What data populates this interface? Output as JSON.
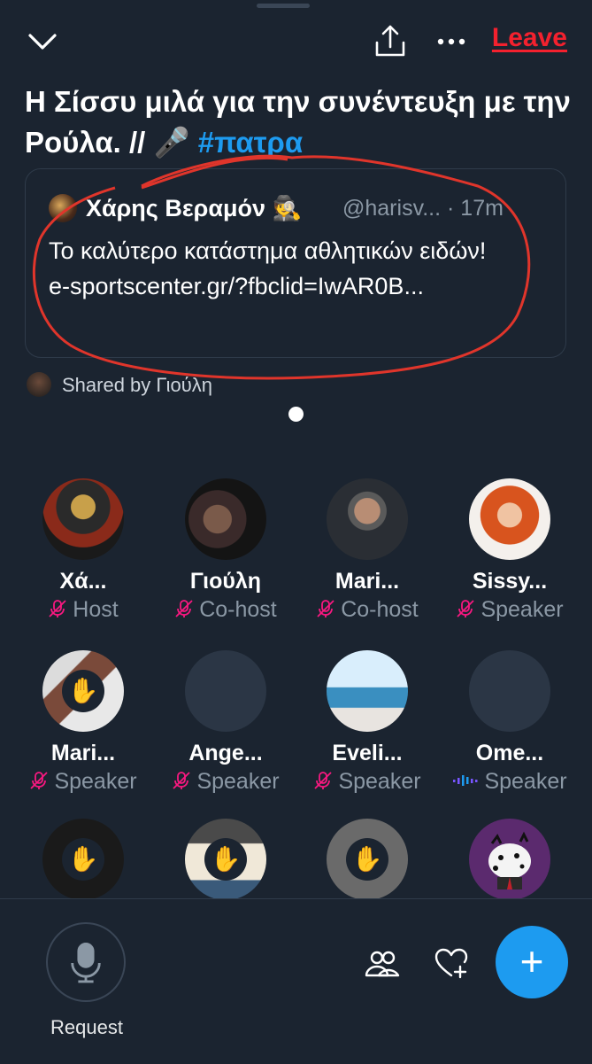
{
  "header": {
    "leave_label": "Leave"
  },
  "space": {
    "title_text": "Η Σίσσυ μιλά για την συνέντευξη με την Ρούλα. // 🎤 ",
    "hashtag": "#πατρα"
  },
  "pinned_tweet": {
    "author_name": "Χάρης Βεραμόν 🕵️",
    "handle": "@harisv...",
    "time": "· 17m",
    "text": "Το καλύτερο κατάστημα αθλητικών ειδών!",
    "link": "e-sportscenter.gr/?fbclid=IwAR0B..."
  },
  "shared_by": {
    "label": "Shared by Γιούλη"
  },
  "speakers": [
    {
      "name": "Χά...",
      "role": "Host"
    },
    {
      "name": "Γιούλη",
      "role": "Co-host"
    },
    {
      "name": "Mari...",
      "role": "Co-host"
    },
    {
      "name": "Sissy...",
      "role": "Speaker"
    },
    {
      "name": "Mari...",
      "role": "Speaker"
    },
    {
      "name": "Ange...",
      "role": "Speaker"
    },
    {
      "name": "Eveli...",
      "role": "Speaker"
    },
    {
      "name": "Ome...",
      "role": "Speaker"
    }
  ],
  "listeners_partial": [
    "hand-raised",
    "hand-raised",
    "hand-raised",
    "dalmatian-avatar"
  ],
  "bottom": {
    "request_label": "Request"
  },
  "colors": {
    "accent": "#1d9bf0",
    "leave": "#f4212e",
    "mic_off": "#f91880",
    "background": "#1b2430"
  },
  "icons": [
    "chevron-down-icon",
    "share-icon",
    "more-icon",
    "mic-off-icon",
    "raised-hand-icon",
    "microphone-icon",
    "people-icon",
    "heart-plus-icon",
    "plus-icon"
  ]
}
